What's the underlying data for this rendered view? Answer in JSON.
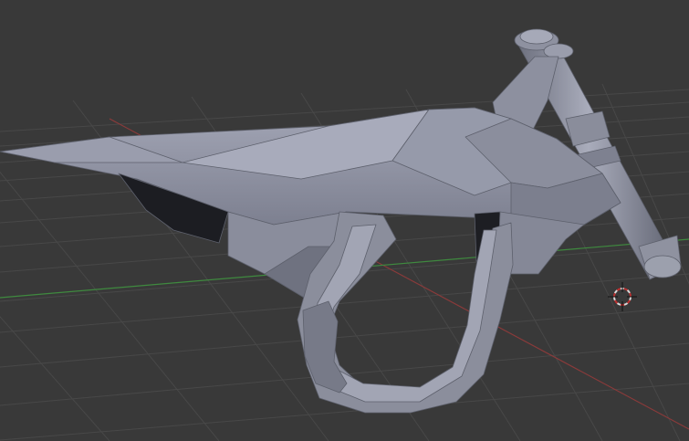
{
  "viewport": {
    "kind": "3d-viewport",
    "background_color": "#393939",
    "grid_color": "#4a4a4a",
    "x_axis_color": "#8a3a3a",
    "y_axis_color": "#3f8a3f",
    "object": {
      "icon": "mesh-object",
      "shading": "solid",
      "base_color": "#8c8f9e"
    },
    "cursor": {
      "icon": "3d-cursor-icon",
      "ring_colors": [
        "#d0d0d0",
        "#c03030"
      ]
    }
  }
}
